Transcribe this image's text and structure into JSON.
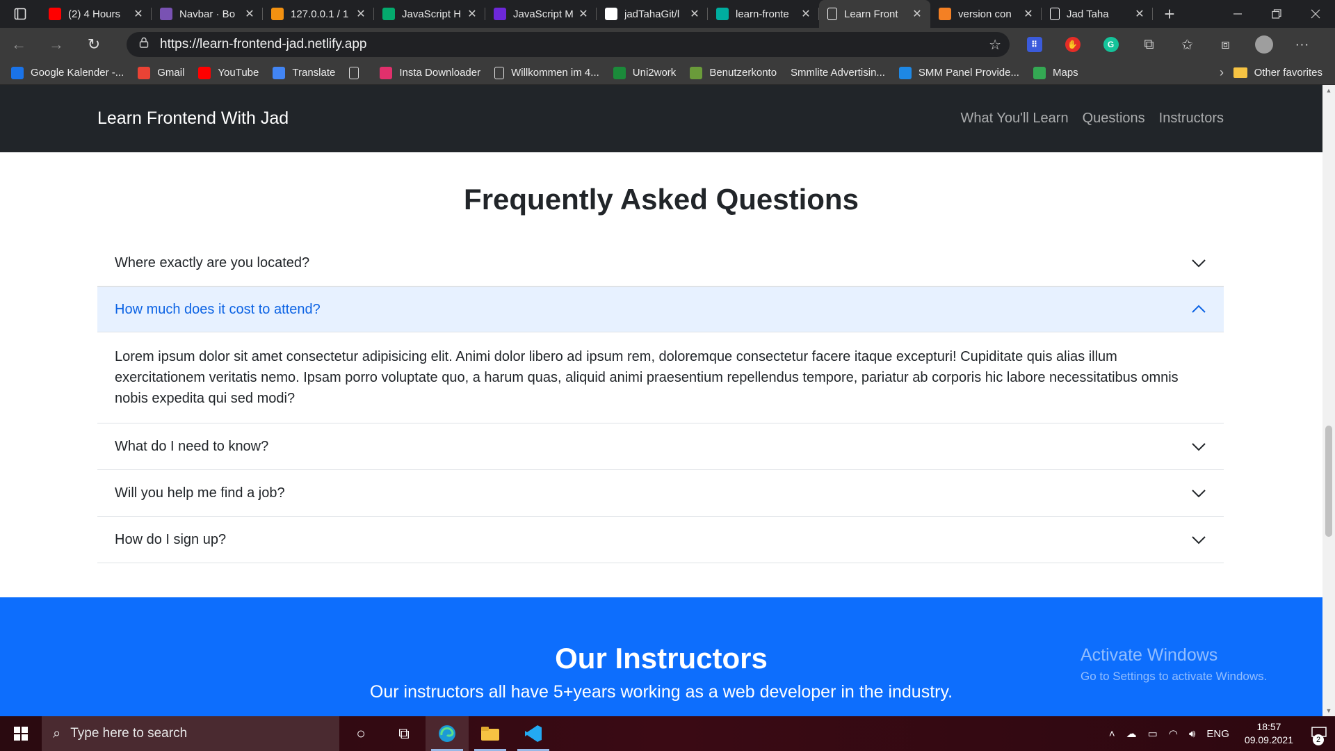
{
  "browser": {
    "tabs": [
      {
        "title": "(2) 4 Hours",
        "icon": "youtube-icon",
        "color": "#ff0000"
      },
      {
        "title": "Navbar · Bo",
        "icon": "bootstrap-icon",
        "color": "#7952b3"
      },
      {
        "title": "127.0.0.1 / 1",
        "icon": "phpmyadmin-icon",
        "color": "#f29111"
      },
      {
        "title": "JavaScript H",
        "icon": "w3schools-icon",
        "color": "#04aa6d"
      },
      {
        "title": "JavaScript M",
        "icon": "tab-icon",
        "color": "#6d28d9"
      },
      {
        "title": "jadTahaGit/l",
        "icon": "github-icon",
        "color": "#ffffff"
      },
      {
        "title": "learn-fronte",
        "icon": "netlify-icon",
        "color": "#00ad9f"
      },
      {
        "title": "Learn Front",
        "icon": "page-icon",
        "color": "#ffffff",
        "active": true
      },
      {
        "title": "version con",
        "icon": "stackoverflow-icon",
        "color": "#f48024"
      },
      {
        "title": "Jad Taha",
        "icon": "page-icon",
        "color": "#ffffff"
      }
    ],
    "tab_close_glyph": "✕",
    "new_tab_glyph": "+",
    "url": "https://learn-frontend-jad.netlify.app",
    "bookmarks": [
      {
        "label": "Google Kalender -...",
        "icon": "calendar-icon",
        "color": "#1a73e8"
      },
      {
        "label": "Gmail",
        "icon": "gmail-icon",
        "color": "#ea4335"
      },
      {
        "label": "YouTube",
        "icon": "youtube-icon",
        "color": "#ff0000"
      },
      {
        "label": "Translate",
        "icon": "translate-icon",
        "color": "#4285f4"
      },
      {
        "label": "",
        "icon": "page-icon",
        "color": "#3b3b3b"
      },
      {
        "label": "Insta Downloader",
        "icon": "instagram-icon",
        "color": "#e1306c"
      },
      {
        "label": "Willkommen im 4...",
        "icon": "page-icon",
        "color": "#3b3b3b"
      },
      {
        "label": "Uni2work",
        "icon": "uni2work-icon",
        "color": "#1b8a3a"
      },
      {
        "label": "Benutzerkonto",
        "icon": "account-icon",
        "color": "#6a9b3a"
      },
      {
        "label": "Smmlite Advertisin...",
        "icon": "blank-icon",
        "color": "#3b3b3b"
      },
      {
        "label": "SMM Panel Provide...",
        "icon": "check-icon",
        "color": "#1e88e5"
      },
      {
        "label": "Maps",
        "icon": "maps-icon",
        "color": "#34a853"
      }
    ],
    "other_favorites": "Other favorites"
  },
  "site": {
    "brand": "Learn Frontend With Jad",
    "nav": [
      "What You'll Learn",
      "Questions",
      "Instructors"
    ],
    "faq_title": "Frequently Asked Questions",
    "faq": [
      {
        "q": "Where exactly are you located?",
        "open": false
      },
      {
        "q": "How much does it cost to attend?",
        "open": true,
        "a": "Lorem ipsum dolor sit amet consectetur adipisicing elit. Animi dolor libero ad ipsum rem, doloremque consectetur facere itaque excepturi! Cupiditate quis alias illum exercitationem veritatis nemo. Ipsam porro voluptate quo, a harum quas, aliquid animi praesentium repellendus tempore, pariatur ab corporis hic labore necessitatibus omnis nobis expedita qui sed modi?"
      },
      {
        "q": "What do I need to know?",
        "open": false
      },
      {
        "q": "Will you help me find a job?",
        "open": false
      },
      {
        "q": "How do I sign up?",
        "open": false
      }
    ],
    "instructors_title": "Our Instructors",
    "instructors_sub": "Our instructors all have 5+years working as a web developer in the industry."
  },
  "watermark": {
    "line1": "Activate Windows",
    "line2": "Go to Settings to activate Windows."
  },
  "taskbar": {
    "search_placeholder": "Type here to search",
    "language": "ENG",
    "time": "18:57",
    "date": "09.09.2021",
    "notification_count": "2"
  },
  "colors": {
    "navbar_bg": "#212529",
    "accordion_open_bg": "#e7f1ff",
    "accordion_open_text": "#0c63e4",
    "instructors_bg": "#0d6efd"
  }
}
